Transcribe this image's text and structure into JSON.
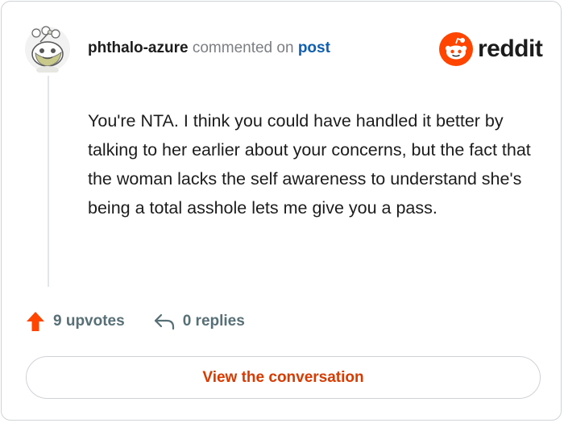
{
  "comment": {
    "username": "phthalo-azure",
    "action": "commented on",
    "post_link": "post",
    "body": "You're NTA. I think you could have handled it better by talking to her earlier about your concerns, but the fact that the woman lacks the self awareness to understand she's being a total asshole lets me give you a pass."
  },
  "brand": {
    "name": "reddit",
    "accent_color": "#ff4500",
    "logo_icon": "reddit-snoo-icon"
  },
  "stats": {
    "upvotes_label": "9 upvotes",
    "upvote_icon": "upvote-arrow-icon",
    "upvote_color": "#ff4500",
    "replies_label": "0 replies",
    "reply_icon": "reply-arrow-icon"
  },
  "cta": {
    "label": "View the conversation",
    "color": "#d93a00"
  }
}
